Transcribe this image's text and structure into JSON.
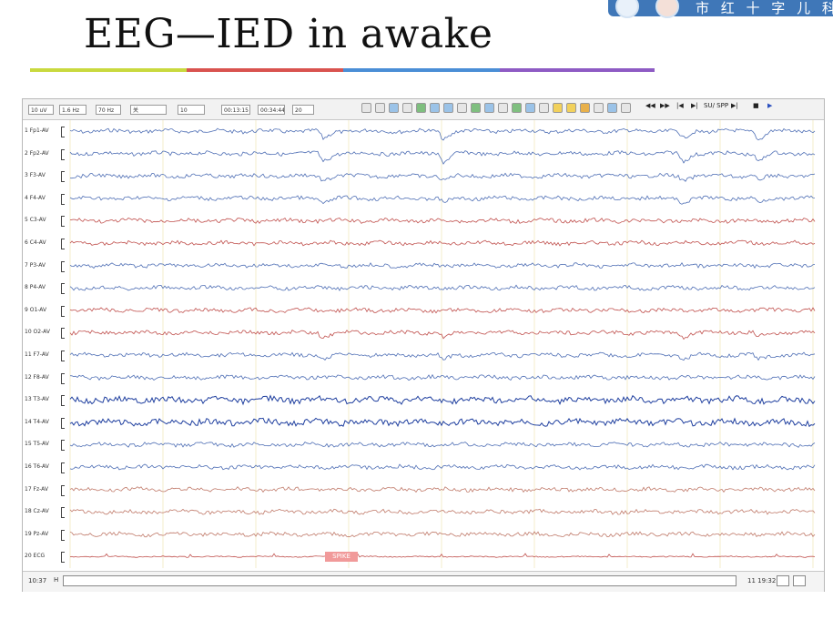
{
  "slide": {
    "title": "EEG—IED in awake",
    "rule_colors": [
      "#c9d93e",
      "#d9534f",
      "#4a8ed6",
      "#8e5bc4"
    ]
  },
  "logo": {
    "text": "市 红 十 字 儿 科 医",
    "background": "#3f77b8"
  },
  "toolbar": {
    "fields": [
      "10 uV",
      "1.6 Hz",
      "70 Hz",
      "关",
      "10",
      "00:13:15",
      "00:34:44",
      "20"
    ],
    "nav_labels": [
      "◀◀",
      "▶▶",
      "|◀",
      "▶|",
      "SU/ SPP",
      "▶|",
      "■",
      "▶"
    ]
  },
  "channels": [
    {
      "label": "1 Fp1-AV",
      "color": "#4f6fb5"
    },
    {
      "label": "2 Fp2-AV",
      "color": "#4f6fb5"
    },
    {
      "label": "3 F3-AV",
      "color": "#4f6fb5"
    },
    {
      "label": "4 F4-AV",
      "color": "#4f6fb5"
    },
    {
      "label": "5 C3-AV",
      "color": "#c0504d"
    },
    {
      "label": "6 C4-AV",
      "color": "#c0504d"
    },
    {
      "label": "7 P3-AV",
      "color": "#4f6fb5"
    },
    {
      "label": "8 P4-AV",
      "color": "#4f6fb5"
    },
    {
      "label": "9 O1-AV",
      "color": "#c0504d"
    },
    {
      "label": "10 O2-AV",
      "color": "#c0504d"
    },
    {
      "label": "11 F7-AV",
      "color": "#4f6fb5"
    },
    {
      "label": "12 F8-AV",
      "color": "#4f6fb5"
    },
    {
      "label": "13 T3-AV",
      "color": "#1f3f9f"
    },
    {
      "label": "14 T4-AV",
      "color": "#1f3f9f"
    },
    {
      "label": "15 T5-AV",
      "color": "#4f6fb5"
    },
    {
      "label": "16 T6-AV",
      "color": "#4f6fb5"
    },
    {
      "label": "17 Fz-AV",
      "color": "#c07a6a"
    },
    {
      "label": "18 Cz-AV",
      "color": "#c07a6a"
    },
    {
      "label": "19 Pz-AV",
      "color": "#c07a6a"
    },
    {
      "label": "20 ECG",
      "color": "#c0504d"
    }
  ],
  "event_marker": "SPIKE",
  "statusbar": {
    "time": "10:37",
    "marker": "H",
    "right_text": "11   19:32"
  }
}
